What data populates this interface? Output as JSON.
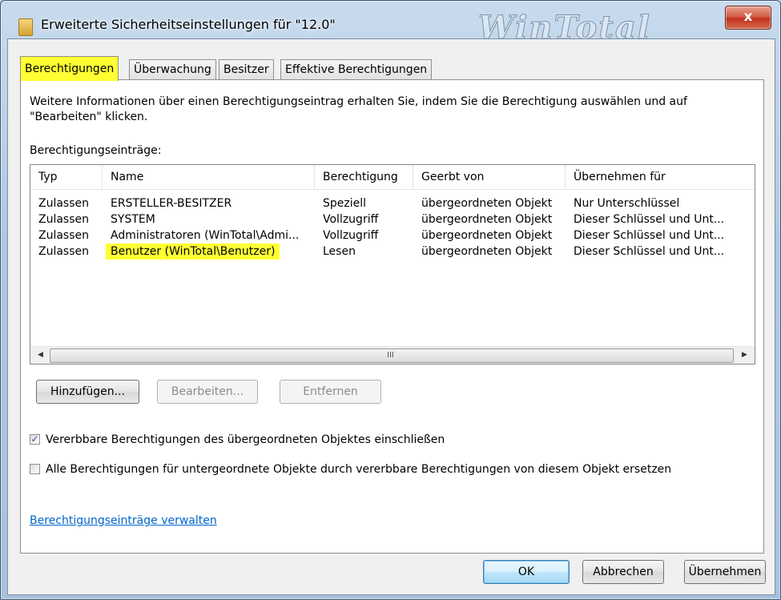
{
  "window": {
    "title": "Erweiterte Sicherheitseinstellungen für \"12.0\"",
    "watermark": "WinTotal",
    "close_glyph": "x"
  },
  "tabs": [
    {
      "label": "Berechtigungen",
      "active": true
    },
    {
      "label": "Überwachung",
      "active": false
    },
    {
      "label": "Besitzer",
      "active": false
    },
    {
      "label": "Effektive Berechtigungen",
      "active": false
    }
  ],
  "info_text": "Weitere Informationen über einen Berechtigungseintrag erhalten Sie, indem Sie die Berechtigung auswählen und auf \"Bearbeiten\" klicken.",
  "entries_label": "Berechtigungseinträge:",
  "list": {
    "columns": [
      "Typ",
      "Name",
      "Berechtigung",
      "Geerbt von",
      "Übernehmen für"
    ],
    "rows": [
      [
        "Zulassen",
        "ERSTELLER-BESITZER",
        "Speziell",
        "übergeordneten Objekt",
        "Nur Unterschlüssel"
      ],
      [
        "Zulassen",
        "SYSTEM",
        "Vollzugriff",
        "übergeordneten Objekt",
        "Dieser Schlüssel und Unt..."
      ],
      [
        "Zulassen",
        "Administratoren (WinTotal\\Admi...",
        "Vollzugriff",
        "übergeordneten Objekt",
        "Dieser Schlüssel und Unt..."
      ],
      [
        "Zulassen",
        "Benutzer (WinTotal\\Benutzer)",
        "Lesen",
        "übergeordneten Objekt",
        "Dieser Schlüssel und Unt..."
      ]
    ],
    "scroll_grip": "III"
  },
  "buttons": {
    "add": "Hinzufügen...",
    "edit": "Bearbeiten...",
    "remove": "Entfernen",
    "ok": "OK",
    "cancel": "Abbrechen",
    "apply": "Übernehmen"
  },
  "checkboxes": {
    "inherit": {
      "label": "Vererbbare Berechtigungen des übergeordneten Objektes einschließen",
      "checked": true
    },
    "replace": {
      "label": "Alle Berechtigungen für untergeordnete Objekte durch vererbbare Berechtigungen von diesem Objekt ersetzen",
      "checked": false
    }
  },
  "manage_link": "Berechtigungseinträge verwalten",
  "colors": {
    "highlight": "#ffff33",
    "link": "#0066cc"
  }
}
